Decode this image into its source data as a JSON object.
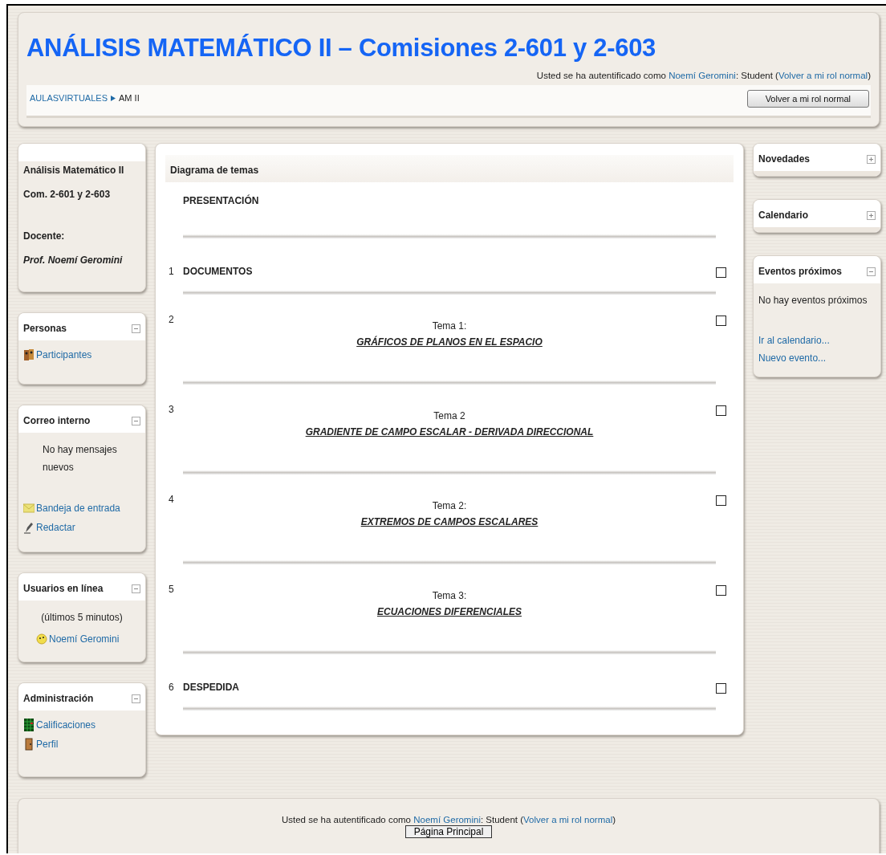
{
  "header": {
    "title": "ANÁLISIS MATEMÁTICO II – Comisiones 2-601 y 2-603",
    "login": {
      "prefix": "Usted se ha autentificado como ",
      "user": "Noemí Geromini",
      "middle": ": Student (",
      "link": "Volver a mi rol normal",
      "suffix": ")"
    },
    "breadcrumb": {
      "link": "AULASVIRTUALES",
      "current": "AM II"
    },
    "button": "Volver a mi rol normal"
  },
  "left_blocks": [
    {
      "kind": "info",
      "lines": [
        "Análisis Matemático II",
        "Com. 2-601 y 2-603",
        "Docente:",
        "Prof. Noemí Geromini"
      ]
    },
    {
      "kind": "block",
      "title": "Personas",
      "collapsed": false,
      "items": [
        {
          "kind": "link",
          "label": "Participantes"
        }
      ]
    },
    {
      "kind": "block",
      "title": "Correo interno",
      "collapsed": false,
      "items": [
        {
          "kind": "note",
          "label": "No hay mensajes nuevos"
        },
        {
          "kind": "link",
          "label": "Bandeja de entrada"
        },
        {
          "kind": "link",
          "label": "Redactar"
        }
      ]
    },
    {
      "kind": "block",
      "title": "Usuarios en línea",
      "collapsed": false,
      "items": [
        {
          "kind": "center",
          "label": "(últimos 5 minutos)"
        },
        {
          "kind": "link",
          "label": "Noemí Geromini"
        }
      ]
    },
    {
      "kind": "block",
      "title": "Administración",
      "collapsed": false,
      "items": [
        {
          "kind": "link",
          "label": "Calificaciones"
        },
        {
          "kind": "link",
          "label": "Perfil"
        }
      ]
    }
  ],
  "main": {
    "title": "Diagrama de temas",
    "sections": [
      {
        "kind": "heading",
        "title": "PRESENTACIÓN"
      },
      {
        "kind": "heading",
        "number": "1",
        "title": "DOCUMENTOS"
      },
      {
        "kind": "topic",
        "number": "2",
        "title": "Tema 1:",
        "subtitle": "GRÁFICOS DE PLANOS EN EL ESPACIO"
      },
      {
        "kind": "topic",
        "number": "3",
        "title": "Tema 2",
        "subtitle": "GRADIENTE DE CAMPO ESCALAR - DERIVADA DIRECCIONAL"
      },
      {
        "kind": "topic",
        "number": "4",
        "title": "Tema 2:",
        "subtitle": "EXTREMOS DE CAMPOS ESCALARES"
      },
      {
        "kind": "topic",
        "number": "5",
        "title": "Tema 3:",
        "subtitle": "ECUACIONES DIFERENCIALES"
      },
      {
        "kind": "heading",
        "number": "6",
        "title": "DESPEDIDA"
      }
    ]
  },
  "right_blocks": [
    {
      "kind": "block",
      "title": "Novedades",
      "collapsed": true
    },
    {
      "kind": "block",
      "title": "Calendario",
      "collapsed": true
    },
    {
      "kind": "block",
      "title": "Eventos próximos",
      "collapsed": false,
      "items": [
        {
          "kind": "note",
          "label": "No hay eventos próximos"
        },
        {
          "kind": "link",
          "label": "Ir al calendario..."
        },
        {
          "kind": "link",
          "label": "Nuevo evento..."
        }
      ]
    }
  ],
  "footer": {
    "login": {
      "prefix": "Usted se ha autentificado como ",
      "user": "Noemí Geromini",
      "middle": ": Student (",
      "link": "Volver a mi rol normal",
      "suffix": ")"
    },
    "button": "Página Principal"
  }
}
